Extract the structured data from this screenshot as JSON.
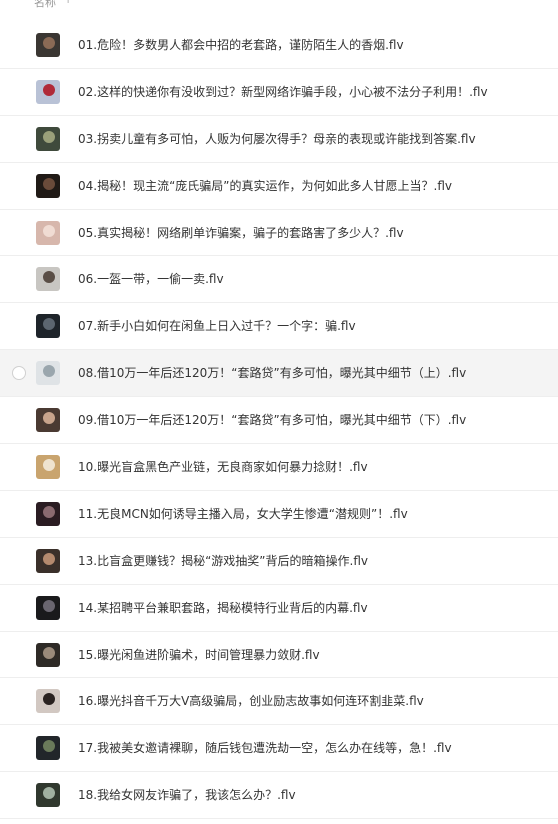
{
  "header": {
    "column_label": "名称",
    "sort_icon": "arrow-up-icon"
  },
  "hover_index": 7,
  "files": [
    {
      "name": "01.危险！多数男人都会中招的老套路，谨防陌生人的香烟.flv",
      "thumb": [
        "#3a3632",
        "#8a6a55"
      ]
    },
    {
      "name": "02.这样的快递你有没收到过？新型网络诈骗手段，小心被不法分子利用！.flv",
      "thumb": [
        "#b9c2d6",
        "#b02a38"
      ]
    },
    {
      "name": "03.拐卖儿童有多可怕，人贩为何屡次得手？母亲的表现或许能找到答案.flv",
      "thumb": [
        "#3f4a3c",
        "#9aa07a"
      ]
    },
    {
      "name": "04.揭秘！现主流“庞氏骗局”的真实运作，为何如此多人甘愿上当？.flv",
      "thumb": [
        "#201a16",
        "#6a4b3a"
      ]
    },
    {
      "name": "05.真实揭秘！网络刷单诈骗案，骗子的套路害了多少人？.flv",
      "thumb": [
        "#d7b7ac",
        "#f0dcd3"
      ]
    },
    {
      "name": "06.一盔一带，一偷一卖.flv",
      "thumb": [
        "#c8c6c2",
        "#5a4e46"
      ]
    },
    {
      "name": "07.新手小白如何在闲鱼上日入过千？一个字：骗.flv",
      "thumb": [
        "#1e242a",
        "#5c6670"
      ]
    },
    {
      "name": "08.借10万一年后还120万！“套路贷”有多可怕，曝光其中细节（上）.flv",
      "thumb": [
        "#dfe3e6",
        "#9aa6ad"
      ]
    },
    {
      "name": "09.借10万一年后还120万！“套路贷”有多可怕，曝光其中细节（下）.flv",
      "thumb": [
        "#4a3a32",
        "#c8a48c"
      ]
    },
    {
      "name": "10.曝光盲盒黑色产业链，无良商家如何暴力捻财！.flv",
      "thumb": [
        "#c9a46e",
        "#efe3cf"
      ]
    },
    {
      "name": "11.无良MCN如何诱导主播入局，女大学生惨遭“潜规则”！.flv",
      "thumb": [
        "#2a1c22",
        "#8a6a70"
      ]
    },
    {
      "name": "13.比盲盒更赚钱？揭秘“游戏抽奖”背后的暗箱操作.flv",
      "thumb": [
        "#3a302a",
        "#b48a6e"
      ]
    },
    {
      "name": "14.某招聘平台兼职套路，揭秘模特行业背后的内幕.flv",
      "thumb": [
        "#1a1a1c",
        "#6a6670"
      ]
    },
    {
      "name": "15.曝光闲鱼进阶骗术，时间管理暴力敛财.flv",
      "thumb": [
        "#2e2a26",
        "#9a8a7a"
      ]
    },
    {
      "name": "16.曝光抖音千万大V高级骗局，创业励志故事如何连环割韭菜.flv",
      "thumb": [
        "#d2c8c2",
        "#2a2220"
      ]
    },
    {
      "name": "17.我被美女邀请裸聊，随后钱包遭洗劫一空，怎么办在线等，急！.flv",
      "thumb": [
        "#22262a",
        "#6a7a5a"
      ]
    },
    {
      "name": "18.我给女网友诈骗了，我该怎么办？.flv",
      "thumb": [
        "#30382e",
        "#a0b0a0"
      ]
    }
  ]
}
